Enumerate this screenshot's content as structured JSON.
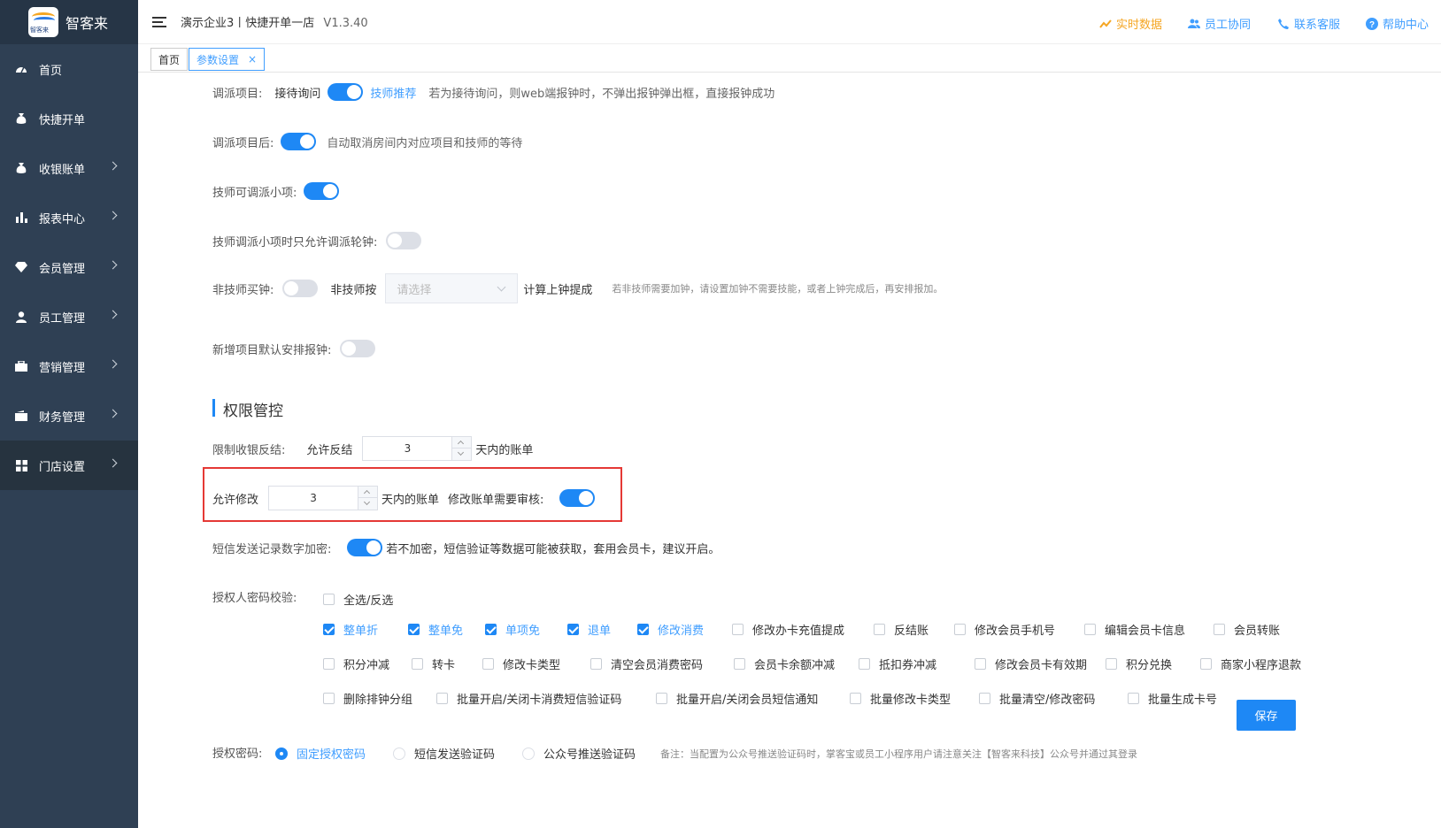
{
  "sidebar": {
    "logo_icon_text": "智客来",
    "logo_text": "智客来",
    "items": [
      {
        "label": "首页",
        "icon": "dashboard-icon"
      },
      {
        "label": "快捷开单",
        "icon": "moneybag-icon"
      },
      {
        "label": "收银账单",
        "icon": "moneybag-icon"
      },
      {
        "label": "报表中心",
        "icon": "bar-chart-icon"
      },
      {
        "label": "会员管理",
        "icon": "diamond-icon"
      },
      {
        "label": "员工管理",
        "icon": "user-icon"
      },
      {
        "label": "营销管理",
        "icon": "briefcase-icon"
      },
      {
        "label": "财务管理",
        "icon": "wallet-icon"
      },
      {
        "label": "门店设置",
        "icon": "grid-icon"
      }
    ]
  },
  "topbar": {
    "title": "演示企业3丨快捷开单一店",
    "version": "V1.3.40",
    "links": {
      "realtime": "实时数据",
      "staff": "员工协同",
      "contact": "联系客服",
      "help": "帮助中心"
    }
  },
  "tabs": [
    {
      "label": "首页"
    },
    {
      "label": "参数设置",
      "close": "×"
    }
  ],
  "settings": {
    "dispatch_item": {
      "label": "调派项目:",
      "left": "接待询问",
      "right": "技师推荐",
      "hint": "若为接待询问，则web端报钟时，不弹出报钟弹出框，直接报钟成功",
      "on": true
    },
    "after_dispatch": {
      "label": "调派项目后:",
      "hint": "自动取消房间内对应项目和技师的等待",
      "on": true
    },
    "tech_dispatch_small": {
      "label": "技师可调派小项:",
      "on": true
    },
    "tech_dispatch_rotate": {
      "label": "技师调派小项时只允许调派轮钟:",
      "on": false
    },
    "non_tech_buy": {
      "label": "非技师买钟:",
      "by_label": "非技师按",
      "select_placeholder": "请选择",
      "calc": "计算上钟提成",
      "hint": "若非技师需要加钟，请设置加钟不需要技能，或者上钟完成后，再安排报加。",
      "on": false
    },
    "new_item_default": {
      "label": "新增项目默认安排报钟:",
      "on": false
    }
  },
  "permission": {
    "section_title": "权限管控",
    "limit_reverse": {
      "label": "限制收银反结:",
      "allow": "允许反结",
      "value": "3",
      "suffix": "天内的账单"
    },
    "allow_modify": {
      "allow": "允许修改",
      "value": "3",
      "suffix": "天内的账单",
      "audit_label": "修改账单需要审核:",
      "on": true
    },
    "sms_encrypt": {
      "label": "短信发送记录数字加密:",
      "hint": "若不加密，短信验证等数据可能被获取，套用会员卡，建议开启。",
      "on": true
    },
    "auth_check": {
      "label": "授权人密码校验:",
      "select_all": "全选/反选",
      "row1": [
        {
          "label": "整单折",
          "checked": true
        },
        {
          "label": "整单免",
          "checked": true
        },
        {
          "label": "单项免",
          "checked": true
        },
        {
          "label": "退单",
          "checked": true
        },
        {
          "label": "修改消费",
          "checked": true
        },
        {
          "label": "修改办卡充值提成",
          "checked": false
        },
        {
          "label": "反结账",
          "checked": false
        },
        {
          "label": "修改会员手机号",
          "checked": false
        },
        {
          "label": "编辑会员卡信息",
          "checked": false
        },
        {
          "label": "会员转账",
          "checked": false
        }
      ],
      "row2": [
        {
          "label": "积分冲减",
          "checked": false
        },
        {
          "label": "转卡",
          "checked": false
        },
        {
          "label": "修改卡类型",
          "checked": false
        },
        {
          "label": "清空会员消费密码",
          "checked": false
        },
        {
          "label": "会员卡余额冲减",
          "checked": false
        },
        {
          "label": "抵扣券冲减",
          "checked": false
        },
        {
          "label": "修改会员卡有效期",
          "checked": false
        },
        {
          "label": "积分兑换",
          "checked": false
        },
        {
          "label": "商家小程序退款",
          "checked": false
        }
      ],
      "row3": [
        {
          "label": "删除排钟分组",
          "checked": false
        },
        {
          "label": "批量开启/关闭卡消费短信验证码",
          "checked": false
        },
        {
          "label": "批量开启/关闭会员短信通知",
          "checked": false
        },
        {
          "label": "批量修改卡类型",
          "checked": false
        },
        {
          "label": "批量清空/修改密码",
          "checked": false
        },
        {
          "label": "批量生成卡号",
          "checked": false
        }
      ]
    },
    "save": "保存",
    "auth_pwd": {
      "label": "授权密码:",
      "options": [
        {
          "label": "固定授权密码",
          "selected": true
        },
        {
          "label": "短信发送验证码",
          "selected": false
        },
        {
          "label": "公众号推送验证码",
          "selected": false
        }
      ],
      "note": "备注：当配置为公众号推送验证码时，掌客宝或员工小程序用户请注意关注【智客来科技】公众号并通过其登录"
    }
  }
}
